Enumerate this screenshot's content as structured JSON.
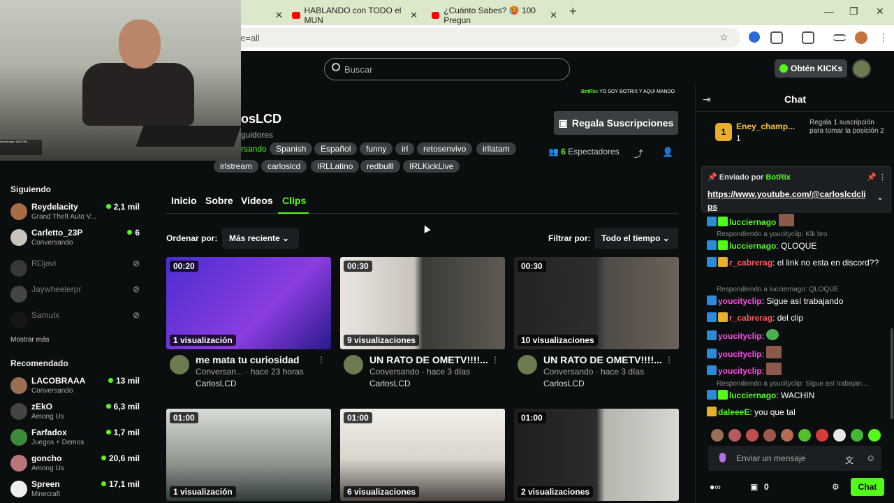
{
  "browser": {
    "tabs": [
      {
        "title": "HABLANDO con TODO el MUN"
      },
      {
        "title": "¿Cuánto Sabes? 🥵 100 Pregun"
      }
    ],
    "address_fragment": "e=all",
    "new_tab": "+",
    "window_controls": [
      "—",
      "❐",
      "✕"
    ]
  },
  "header": {
    "search_placeholder": "Buscar",
    "kicks_button": "Obtén KICKs"
  },
  "webcam": {
    "overlay_text": "lucciernago: WACHIN"
  },
  "sidebar": {
    "following_title": "Siguiendo",
    "following": [
      {
        "name": "Reydelacity",
        "sub": "Grand Theft Auto V...",
        "viewers": "2,1 mil",
        "live": true,
        "color": "#a86b46"
      },
      {
        "name": "Carletto_23P",
        "sub": "Conversando",
        "viewers": "6",
        "live": true,
        "color": "#c9c4bb"
      },
      {
        "name": "RDjavi",
        "sub": "",
        "viewers": "⊘",
        "live": false,
        "color": "#777"
      },
      {
        "name": "Jaywheelerpr",
        "sub": "",
        "viewers": "⊘",
        "live": false,
        "color": "#999"
      },
      {
        "name": "Samulx",
        "sub": "",
        "viewers": "⊘",
        "live": false,
        "color": "#222"
      }
    ],
    "show_more": "Mostrar más",
    "recommended_title": "Recomendado",
    "recommended": [
      {
        "name": "LACOBRAAA",
        "sub": "Conversando",
        "viewers": "13 mil",
        "color": "#9a6f55"
      },
      {
        "name": "zEkO",
        "sub": "Among Us",
        "viewers": "6,3 mil",
        "color": "#444"
      },
      {
        "name": "Farfadox",
        "sub": "Juegos + Demos",
        "viewers": "1,7 mil",
        "color": "#3d8a3a"
      },
      {
        "name": "goncho",
        "sub": "Among Us",
        "viewers": "20,6 mil",
        "color": "#b8757a"
      },
      {
        "name": "Spreen",
        "sub": "Minecraft",
        "viewers": "17,1 mil",
        "color": "#eee"
      }
    ]
  },
  "channel": {
    "banner_user": "BotRix",
    "banner_text": ": YO SOY BOTRIX Y AQUI MANDO",
    "name": "osLCD",
    "followers": "guidores",
    "category": "rsando",
    "tags": [
      "Spanish",
      "Español",
      "funny",
      "irl",
      "retosenvivo",
      "irllatam",
      "irlstream",
      "carloslcd",
      "IRLLatino",
      "redbulll",
      "IRLKickLive"
    ],
    "gift_button": "Regala Suscripciones",
    "viewers_count": "6",
    "viewers_label": " Espectadores"
  },
  "tabs": [
    {
      "label": "Inicio"
    },
    {
      "label": "Sobre"
    },
    {
      "label": "Videos"
    },
    {
      "label": "Clips"
    }
  ],
  "controls": {
    "sort_label": "Ordenar por:",
    "sort_value": "Más reciente",
    "filter_label": "Filtrar por:",
    "filter_value": "Todo el tiempo"
  },
  "clips": [
    {
      "duration": "00:20",
      "views": "1 visualización",
      "title": "me mata tu curiosidad",
      "meta": "Conversan... · hace 23 horas",
      "author": "CarlosLCD",
      "bg": "linear-gradient(135deg,#4b2ed1,#8b3de0 60%,#2a1a8a)"
    },
    {
      "duration": "00:30",
      "views": "9 visualizaciones",
      "title": "UN RATO DE OMETV!!!!...",
      "meta": "Conversando · hace 3 días",
      "author": "CarlosLCD",
      "bg": "linear-gradient(90deg,#e9e6e1 0%,#c9c3bb 45%,#3b3a36 50%,#5d5a52 100%)"
    },
    {
      "duration": "00:30",
      "views": "10 visualizaciones",
      "title": "UN RATO DE OMETV!!!!...",
      "meta": "Conversando · hace 3 días",
      "author": "CarlosLCD",
      "bg": "linear-gradient(90deg,#232323 0%,#2d2d2d 50%,#4e4a45 55%,#6c6259 100%)"
    },
    {
      "duration": "01:00",
      "views": "1 visualización",
      "title": "",
      "meta": "",
      "author": "",
      "bg": "linear-gradient(180deg,#d8dcd6,#8f948c 60%,#2f3a3a)"
    },
    {
      "duration": "01:00",
      "views": "6 visualizaciones",
      "title": "",
      "meta": "",
      "author": "",
      "bg": "linear-gradient(180deg,#f1efe9,#d8d5cc 55%,#4a4541)"
    },
    {
      "duration": "01:00",
      "views": "2 visualizaciones",
      "title": "",
      "meta": "",
      "author": "",
      "bg": "linear-gradient(90deg,#1f1f1f 0%,#2b2b2b 50%,#b6b5ae 55%,#d7d6d0 100%)"
    }
  ],
  "chat": {
    "title": "Chat",
    "gifter_name": "Eney_champ...",
    "gifter_count": "1",
    "gifter_rank": "1",
    "gifter_text": "Regala 1 suscripción para tomar la posición 2",
    "pinned_by": "Enviado por",
    "pinned_user": "BotRix",
    "pinned_link": "https://www.youtube.com/@carloslcdclips",
    "messages": [
      {
        "user": "lucciernago",
        "text": "",
        "color": "green",
        "reply": ""
      },
      {
        "user": "lucciernago",
        "text": ": QLOQUE",
        "color": "green",
        "reply": "Respondiendo a youcityclip: Klk bro"
      },
      {
        "user": "r_cabrerag",
        "text": ": el link no esta en discord??",
        "color": "red",
        "reply": ""
      },
      {
        "user": "youcityclip",
        "text": ": Sigue así trabajando",
        "color": "mag",
        "reply": "Respondiendo a lucciernago: QLOQUE"
      },
      {
        "user": "r_cabrerag",
        "text": ": del clip",
        "color": "red",
        "reply": ""
      },
      {
        "user": "youcityclip",
        "text": ":",
        "color": "mag",
        "reply": ""
      },
      {
        "user": "youcityclip",
        "text": ":",
        "color": "mag",
        "reply": ""
      },
      {
        "user": "youcityclip",
        "text": ":",
        "color": "mag",
        "reply": ""
      },
      {
        "user": "lucciernago",
        "text": ": WACHIN",
        "color": "green",
        "reply": "Respondiendo a youcityclip: Sigue así trabajan..."
      },
      {
        "user": "daleeeE",
        "text": ": you que tal",
        "color": "gold",
        "reply": ""
      }
    ],
    "input_placeholder": "Enviar un mensaje",
    "points": "0",
    "send_button": "Chat"
  }
}
